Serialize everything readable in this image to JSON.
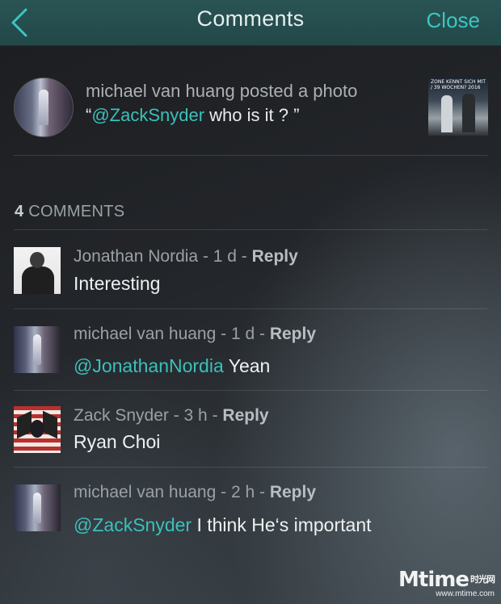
{
  "header": {
    "title": "Comments",
    "close_label": "Close",
    "back_icon": "chevron-left-icon"
  },
  "post": {
    "author_line": "michael van huang posted a photo",
    "quote_open": "“",
    "mention": "@ZackSnyder",
    "text": " who is it ? ”",
    "thumb_text": "ZONE KENNT SICH MIT / 39 WOCHEN? 2016"
  },
  "comments_count": {
    "number": "4",
    "label": " COMMENTS"
  },
  "comments": [
    {
      "head": "Jonathan Nordia - 1 d - ",
      "reply": "Reply",
      "mention": "",
      "text": "Interesting"
    },
    {
      "head": "michael van huang - 1 d - ",
      "reply": "Reply",
      "mention": "@JonathanNordia",
      "text": "  Yean"
    },
    {
      "head": "Zack Snyder - 3 h - ",
      "reply": "Reply",
      "mention": "",
      "text": "Ryan Choi"
    },
    {
      "head": "michael van huang - 2 h - ",
      "reply": "Reply",
      "mention": "@ZackSnyder",
      "text": " I think He‘s important"
    }
  ],
  "watermark": {
    "logo": "Mtime",
    "cn": "时光网",
    "url": "www.mtime.com"
  },
  "colors": {
    "header_bg": "#2a5454",
    "accent": "#3bc6c0",
    "text_primary": "#eef1f2",
    "text_secondary": "#9aa1a5"
  }
}
